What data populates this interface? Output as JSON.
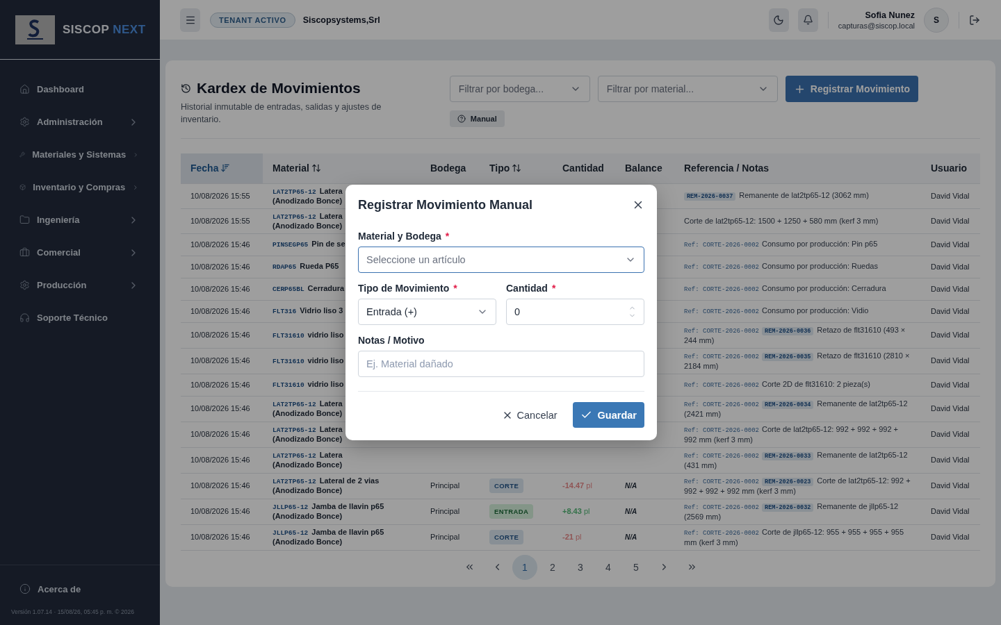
{
  "sidebar": {
    "brand_name": "SISCOP",
    "brand_suffix": "NEXT",
    "items": [
      {
        "label": "Dashboard"
      },
      {
        "label": "Administración",
        "expanded": false
      },
      {
        "label": "Materiales y Sistemas",
        "expanded": false
      },
      {
        "label": "Inventario y Compras",
        "expanded": false
      },
      {
        "label": "Ingeniería",
        "expanded": false
      },
      {
        "label": "Comercial",
        "expanded": false
      },
      {
        "label": "Producción",
        "expanded": false
      },
      {
        "label": "Soporte Técnico"
      }
    ],
    "footer_item": "Acerca de",
    "version": "Versión 1.07.14 · 15/08/26, 05:45 p. m. © 2026"
  },
  "topbar": {
    "tenant_badge": "TENANT ACTIVO",
    "tenant_name": "Siscopsystems,Srl",
    "user_name": "Sofia Nunez",
    "user_email": "capturas@siscop.local",
    "avatar_initial": "S"
  },
  "page": {
    "title": "Kardex de Movimientos",
    "subtitle": "Historial inmutable de entradas, salidas y ajustes de inventario.",
    "filters": [
      {
        "placeholder": "Filtrar por bodega..."
      },
      {
        "placeholder": "Filtrar por material..."
      }
    ],
    "primary_button": "Registrar Movimiento",
    "manual_button": "Manual"
  },
  "table": {
    "columns": [
      {
        "label": "Fecha",
        "kind": "sorted",
        "selected": true
      },
      {
        "label": "Material",
        "kind": "sortable",
        "selected": false
      },
      {
        "label": "Bodega",
        "kind": "plain",
        "selected": false
      },
      {
        "label": "Tipo",
        "kind": "sortable",
        "selected": false
      },
      {
        "label": "Cantidad",
        "kind": "plain",
        "selected": false
      },
      {
        "label": "Balance",
        "kind": "plain",
        "selected": false
      },
      {
        "label": "Referencia / Notas",
        "kind": "plain",
        "selected": false
      },
      {
        "label": "Usuario",
        "kind": "plain",
        "selected": false
      }
    ],
    "rows": [
      {
        "date": "10/08/2026 15:55",
        "code": "LAT2TP65-12",
        "name": "Latera",
        "finish": "(Anodizado Bonce)",
        "reference": [
          {
            "kind": "rem",
            "text": "REM-2026-0037"
          },
          {
            "kind": "note",
            "text": "Remanente de lat2tp65-12 (3062 mm)"
          }
        ],
        "user": "David Vidal"
      },
      {
        "date": "10/08/2026 15:55",
        "code": "LAT2TP65-12",
        "name": "Latera",
        "finish": "(Anodizado Bonce)",
        "reference": [
          {
            "kind": "note",
            "text": "Corte de lat2tp65-12: 1500 + 1250 + 580 mm (kerf 3 mm)"
          }
        ],
        "user": "David Vidal"
      },
      {
        "date": "10/08/2026 15:46",
        "code": "PINSEGP65",
        "name": "Pin de se",
        "reference": [
          {
            "kind": "ref",
            "text": "Ref: CORTE-2026-0002"
          },
          {
            "kind": "note",
            "text": "Consumo por producción: Pin p65"
          }
        ],
        "user": "David Vidal"
      },
      {
        "date": "10/08/2026 15:46",
        "code": "RDAP65",
        "name": "Rueda P65",
        "reference": [
          {
            "kind": "ref",
            "text": "Ref: CORTE-2026-0002"
          },
          {
            "kind": "note",
            "text": "Consumo por producción: Ruedas"
          }
        ],
        "user": "David Vidal"
      },
      {
        "date": "10/08/2026 15:46",
        "code": "CERP65BL",
        "name": "Cerradura",
        "reference": [
          {
            "kind": "ref",
            "text": "Ref: CORTE-2026-0002"
          },
          {
            "kind": "note",
            "text": "Consumo por producción: Cerradura"
          }
        ],
        "user": "David Vidal"
      },
      {
        "date": "10/08/2026 15:46",
        "code": "FLT316",
        "name": "Vidrio liso 3",
        "reference": [
          {
            "kind": "ref",
            "text": "Ref: CORTE-2026-0002"
          },
          {
            "kind": "note",
            "text": "Consumo por producción: Vidio"
          }
        ],
        "user": "David Vidal"
      },
      {
        "date": "10/08/2026 15:46",
        "code": "FLT31610",
        "name": "vidrio liso",
        "reference": [
          {
            "kind": "ref",
            "text": "Ref: CORTE-2026-0002"
          },
          {
            "kind": "rem",
            "text": "REM-2026-0036"
          },
          {
            "kind": "note",
            "text": "Retazo de flt31610 (493 × 244 mm)"
          }
        ],
        "user": "David Vidal"
      },
      {
        "date": "10/08/2026 15:46",
        "code": "FLT31610",
        "name": "vidrio liso",
        "reference": [
          {
            "kind": "ref",
            "text": "Ref: CORTE-2026-0002"
          },
          {
            "kind": "rem",
            "text": "REM-2026-0035"
          },
          {
            "kind": "note",
            "text": "Retazo de flt31610 (2810 × 2184 mm)"
          }
        ],
        "user": "David Vidal"
      },
      {
        "date": "10/08/2026 15:46",
        "code": "FLT31610",
        "name": "vidrio liso",
        "reference": [
          {
            "kind": "ref",
            "text": "Ref: CORTE-2026-0002"
          },
          {
            "kind": "note",
            "text": "Corte 2D de flt31610: 2 pieza(s)"
          }
        ],
        "user": "David Vidal"
      },
      {
        "date": "10/08/2026 15:46",
        "code": "LAT2TP65-12",
        "name": "Latera",
        "finish": "(Anodizado Bonce)",
        "reference": [
          {
            "kind": "ref",
            "text": "Ref: CORTE-2026-0002"
          },
          {
            "kind": "rem",
            "text": "REM-2026-0034"
          },
          {
            "kind": "note",
            "text": "Remanente de lat2tp65-12 (2421 mm)"
          }
        ],
        "user": "David Vidal"
      },
      {
        "date": "10/08/2026 15:46",
        "code": "LAT2TP65-12",
        "name": "Latera",
        "finish": "(Anodizado Bonce)",
        "reference": [
          {
            "kind": "ref",
            "text": "Ref: CORTE-2026-0002"
          },
          {
            "kind": "note",
            "text": "Corte de lat2tp65-12: 992 + 992 + 992 + 992 mm (kerf 3 mm)"
          }
        ],
        "user": "David Vidal"
      },
      {
        "date": "10/08/2026 15:46",
        "code": "LAT2TP65-12",
        "name": "Latera",
        "finish": "(Anodizado Bonce)",
        "reference": [
          {
            "kind": "ref",
            "text": "Ref: CORTE-2026-0002"
          },
          {
            "kind": "rem",
            "text": "REM-2026-0033"
          },
          {
            "kind": "note",
            "text": "Remanente de lat2tp65-12 (431 mm)"
          }
        ],
        "user": "David Vidal"
      },
      {
        "date": "10/08/2026 15:46",
        "code": "LAT2TP65-12",
        "name": "Lateral de 2 vias",
        "finish": "(Anodizado Bonce)",
        "warehouse": "Principal",
        "type": {
          "label": "CORTE",
          "kind": "corte"
        },
        "quantity": "**-14.47** pl",
        "balance": "N/A",
        "reference": [
          {
            "kind": "ref",
            "text": "Ref: CORTE-2026-0002"
          },
          {
            "kind": "rem",
            "text": "REM-2026-0023"
          },
          {
            "kind": "note",
            "text": "Corte de lat2tp65-12: 992 + 992 + 992 + 992 mm (kerf 3 mm)"
          }
        ],
        "user": "David Vidal"
      },
      {
        "date": "10/08/2026 15:46",
        "code": "JLLP65-12",
        "name": "Jamba de llavin p65",
        "finish": "(Anodizado Bonce)",
        "warehouse": "Principal",
        "type": {
          "label": "ENTRADA",
          "kind": "entrada"
        },
        "quantity": "**+8.43** pl",
        "balance": "N/A",
        "reference": [
          {
            "kind": "ref",
            "text": "Ref: CORTE-2026-0002"
          },
          {
            "kind": "rem",
            "text": "REM-2026-0032"
          },
          {
            "kind": "note",
            "text": "Remanente de jllp65-12 (2569 mm)"
          }
        ],
        "user": "David Vidal"
      },
      {
        "date": "10/08/2026 15:46",
        "code": "JLLP65-12",
        "name": "Jamba de llavin p65",
        "finish": "(Anodizado Bonce)",
        "warehouse": "Principal",
        "type": {
          "label": "CORTE",
          "kind": "corte"
        },
        "quantity": "**-21** pl",
        "balance": "N/A",
        "reference": [
          {
            "kind": "ref",
            "text": "Ref: CORTE-2026-0002"
          },
          {
            "kind": "note",
            "text": "Corte de jllp65-12: 955 + 955 + 955 + 955 mm (kerf 3 mm)"
          }
        ],
        "user": "David Vidal"
      }
    ]
  },
  "pagination": {
    "pages": [
      {
        "label": "1",
        "selected": true
      },
      {
        "label": "2",
        "selected": false
      },
      {
        "label": "3",
        "selected": false
      },
      {
        "label": "4",
        "selected": false
      },
      {
        "label": "5",
        "selected": false
      }
    ]
  },
  "modal": {
    "title": "Registrar Movimiento Manual",
    "rows": [
      [
        {
          "kind": "select",
          "label": "Material y Bodega",
          "required_mark": "*",
          "placeholder": "Seleccione un artículo",
          "focused": true
        }
      ],
      [
        {
          "kind": "select",
          "label": "Tipo de Movimiento",
          "required_mark": "*",
          "value": "Entrada (+)",
          "focused": false
        },
        {
          "kind": "number",
          "label": "Cantidad",
          "required_mark": "*",
          "value": "0",
          "focused": false
        }
      ],
      [
        {
          "kind": "text",
          "label": "Notas / Motivo",
          "placeholder": "Ej. Material dañado",
          "focused": false
        }
      ]
    ],
    "cancel_button": "Cancelar",
    "save_button": "Guardar"
  }
}
